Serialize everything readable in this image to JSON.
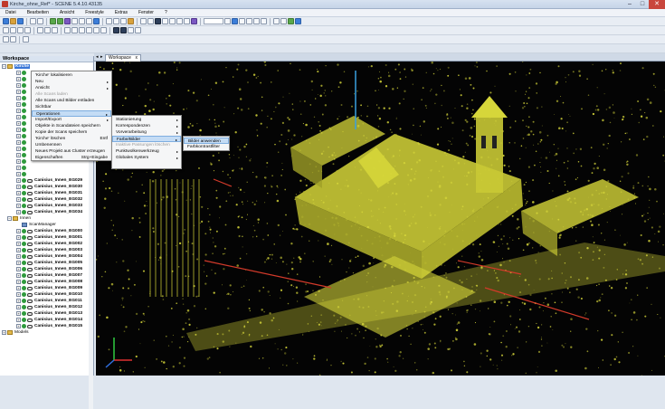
{
  "window": {
    "title": "Kirche_ohne_Ref* - SCENE 5.4.10.43135",
    "min": "–",
    "max": "□",
    "close": "✕"
  },
  "menu": [
    "Datei",
    "Bearbeiten",
    "Ansicht",
    "Freestyle",
    "Extras",
    "Fenster",
    "?"
  ],
  "workspace": {
    "header": "Workspace",
    "root_label": "Kirche",
    "tree": [
      "Canisius_Innen_EG029",
      "Canisius_Innen_EG030",
      "Canisius_Innen_EG031",
      "Canisius_Innen_EG032",
      "Canisius_Innen_EG033",
      "Canisius_Innen_EG034"
    ],
    "innen_label": "Innen",
    "scanmanager_label": "ScanManager",
    "innen_tree": [
      "Canisius_Innen_EG000",
      "Canisius_Innen_EG001",
      "Canisius_Innen_EG002",
      "Canisius_Innen_EG003",
      "Canisius_Innen_EG004",
      "Canisius_Innen_EG005",
      "Canisius_Innen_EG006",
      "Canisius_Innen_EG007",
      "Canisius_Innen_EG008",
      "Canisius_Innen_EG009",
      "Canisius_Innen_EG010",
      "Canisius_Innen_EG011",
      "Canisius_Innen_EG012",
      "Canisius_Innen_EG013",
      "Canisius_Innen_EG014",
      "Canisius_Innen_EG015"
    ],
    "models_label": "Models"
  },
  "tab": {
    "label": "Workspace",
    "close": "x"
  },
  "context_menu": {
    "items": [
      {
        "label": "'Kirche' lokalisieren",
        "disabled": false
      },
      {
        "label": "Neu",
        "arrow": true
      },
      {
        "label": "Ansicht",
        "arrow": true
      },
      {
        "label": "Alle Scans laden",
        "disabled": true
      },
      {
        "label": "Alle Scans und Bilder entladen"
      },
      {
        "label": "Sichtbar"
      },
      {
        "label": "Operationen",
        "arrow": true,
        "highlight": true
      },
      {
        "label": "Import/Export",
        "arrow": true
      },
      {
        "label": "Objekte in Scandateien speichern"
      },
      {
        "label": "Kopie der Scans speichern"
      },
      {
        "label": "'Kirche' löschen",
        "shortcut": "Entf"
      },
      {
        "label": "Umbenennen"
      },
      {
        "label": "Neues Projekt aus Cluster erzeugen"
      },
      {
        "label": "Eigenschaften",
        "shortcut": "Strg+Eingabe"
      }
    ]
  },
  "submenu_operationen": {
    "items": [
      {
        "label": "Stationierung",
        "arrow": true
      },
      {
        "label": "Korrespondenzen",
        "arrow": true
      },
      {
        "label": "Vorverarbeitung",
        "arrow": true
      },
      {
        "label": "Farbe/Bilder",
        "arrow": true,
        "highlight": true
      },
      {
        "label": "Inaktive Passungen löschen",
        "disabled": true
      },
      {
        "label": "Punktwolkenwerkzeug",
        "arrow": true
      },
      {
        "label": "Globales System",
        "arrow": true
      }
    ]
  },
  "submenu_farbe": {
    "items": [
      {
        "label": "Bilder anwenden",
        "highlight": true
      },
      {
        "label": "Farbkontrastfilter"
      }
    ]
  },
  "colors": {
    "pointcloud": "#d6d63a",
    "background": "#040404",
    "highlight": "#c4dcf5"
  }
}
